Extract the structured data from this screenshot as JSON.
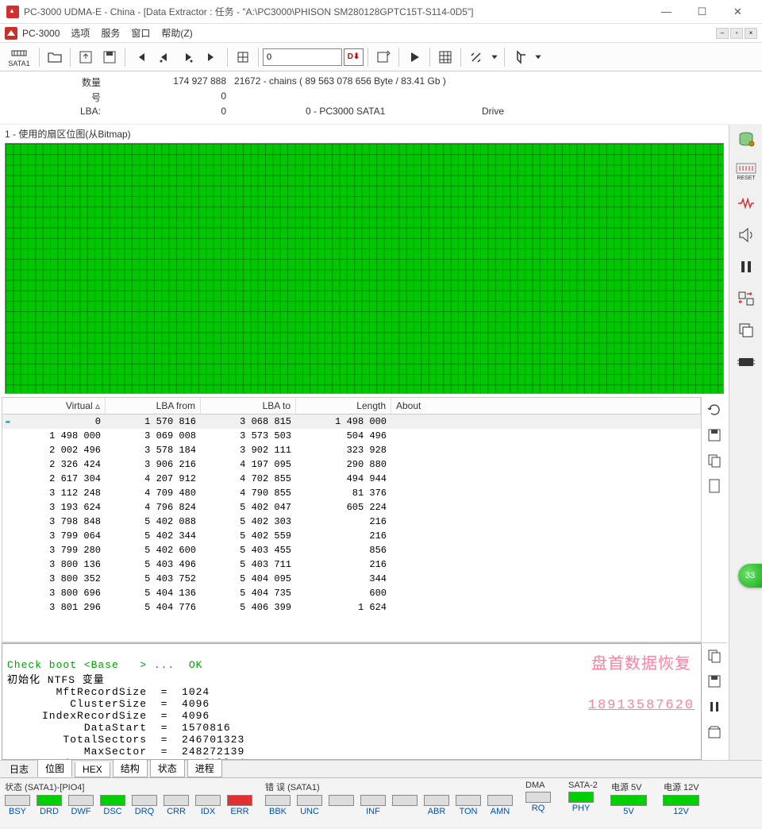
{
  "window": {
    "title": "PC-3000 UDMA-E - China - [Data Extractor : 任务 - \"A:\\PC3000\\PHISON SM280128GPTC15T-S114-0D5\"]",
    "app_name": "PC-3000"
  },
  "menu": {
    "options": "选项",
    "services": "服务",
    "window": "窗口",
    "help": "帮助(Z)"
  },
  "toolbar": {
    "port_label": "SATA1",
    "num_value": "0",
    "dx_label": "D⬇"
  },
  "info": {
    "qty_label": "数量",
    "qty_value": "174 927 888",
    "chains_text": "21672 - chains  ( 89 563 078 656 Byte /  83.41 Gb )",
    "num_label": "号",
    "num_value": "0",
    "lba_label": "LBA:",
    "lba_value": "0",
    "drive_label": "Drive",
    "drive_value": "0 - PC3000 SATA1"
  },
  "sector_panel": {
    "label": "1 - 使用的扇区位图(从Bitmap)"
  },
  "table": {
    "headers": {
      "virtual": "Virtual  ▵",
      "lbafrom": "LBA from",
      "lbato": "LBA to",
      "length": "Length",
      "about": "About"
    },
    "rows": [
      {
        "virtual": "0",
        "lbafrom": "1 570 816",
        "lbato": "3 068 815",
        "length": "1 498 000",
        "about": "",
        "sel": true
      },
      {
        "virtual": "1 498 000",
        "lbafrom": "3 069 008",
        "lbato": "3 573 503",
        "length": "504 496",
        "about": ""
      },
      {
        "virtual": "2 002 496",
        "lbafrom": "3 578 184",
        "lbato": "3 902 111",
        "length": "323 928",
        "about": ""
      },
      {
        "virtual": "2 326 424",
        "lbafrom": "3 906 216",
        "lbato": "4 197 095",
        "length": "290 880",
        "about": ""
      },
      {
        "virtual": "2 617 304",
        "lbafrom": "4 207 912",
        "lbato": "4 702 855",
        "length": "494 944",
        "about": ""
      },
      {
        "virtual": "3 112 248",
        "lbafrom": "4 709 480",
        "lbato": "4 790 855",
        "length": "81 376",
        "about": ""
      },
      {
        "virtual": "3 193 624",
        "lbafrom": "4 796 824",
        "lbato": "5 402 047",
        "length": "605 224",
        "about": ""
      },
      {
        "virtual": "3 798 848",
        "lbafrom": "5 402 088",
        "lbato": "5 402 303",
        "length": "216",
        "about": ""
      },
      {
        "virtual": "3 799 064",
        "lbafrom": "5 402 344",
        "lbato": "5 402 559",
        "length": "216",
        "about": ""
      },
      {
        "virtual": "3 799 280",
        "lbafrom": "5 402 600",
        "lbato": "5 403 455",
        "length": "856",
        "about": ""
      },
      {
        "virtual": "3 800 136",
        "lbafrom": "5 403 496",
        "lbato": "5 403 711",
        "length": "216",
        "about": ""
      },
      {
        "virtual": "3 800 352",
        "lbafrom": "5 403 752",
        "lbato": "5 404 095",
        "length": "344",
        "about": ""
      },
      {
        "virtual": "3 800 696",
        "lbafrom": "5 404 136",
        "lbato": "5 404 735",
        "length": "600",
        "about": ""
      },
      {
        "virtual": "3 801 296",
        "lbafrom": "5 404 776",
        "lbato": "5 406 399",
        "length": "1 624",
        "about": ""
      }
    ]
  },
  "log": {
    "line1": "Check boot <Base   > ...  OK",
    "line2": "初始化 NTFS 变量",
    "line3": "       MftRecordSize  =  1024",
    "line4": "         ClusterSize  =  4096",
    "line5": "     IndexRecordSize  =  4096",
    "line6": "           DataStart  =  1570816",
    "line7": "        TotalSectors  =  246701323",
    "line8": "           MaxSector  =  248272139",
    "line9": "     Load MFT map    -  Map filled"
  },
  "watermark": {
    "line1": "盘首数据恢复",
    "line2": "18913587620"
  },
  "tabs": {
    "log": "日志",
    "bitmap": "位图",
    "hex": "HEX",
    "struct": "结构",
    "status": "状态",
    "progress": "进程"
  },
  "footer": {
    "state_title": "状态 (SATA1)-[PIO4]",
    "error_title": "错 误 (SATA1)",
    "dma": "DMA",
    "sata2": "SATA-2",
    "p5v": "电源 5V",
    "p12v": "电源 12V",
    "leds_state": [
      {
        "t": "BSY",
        "c": "off"
      },
      {
        "t": "DRD",
        "c": "green"
      },
      {
        "t": "DWF",
        "c": "off"
      },
      {
        "t": "DSC",
        "c": "green"
      },
      {
        "t": "DRQ",
        "c": "off"
      },
      {
        "t": "CRR",
        "c": "off"
      },
      {
        "t": "IDX",
        "c": "off"
      },
      {
        "t": "ERR",
        "c": "red"
      }
    ],
    "leds_error": [
      {
        "t": "BBK",
        "c": "off"
      },
      {
        "t": "UNC",
        "c": "off"
      },
      {
        "t": "",
        "c": "off"
      },
      {
        "t": "INF",
        "c": "off"
      },
      {
        "t": "",
        "c": "off"
      },
      {
        "t": "ABR",
        "c": "off"
      },
      {
        "t": "TON",
        "c": "off"
      },
      {
        "t": "AMN",
        "c": "off"
      }
    ],
    "led_dma": {
      "t": "RQ",
      "c": "off"
    },
    "led_sata2": {
      "t": "PHY",
      "c": "green"
    },
    "led_5v": {
      "t": "5V",
      "c": "green"
    },
    "led_12v": {
      "t": "12V",
      "c": "green"
    }
  },
  "bubble": "33"
}
